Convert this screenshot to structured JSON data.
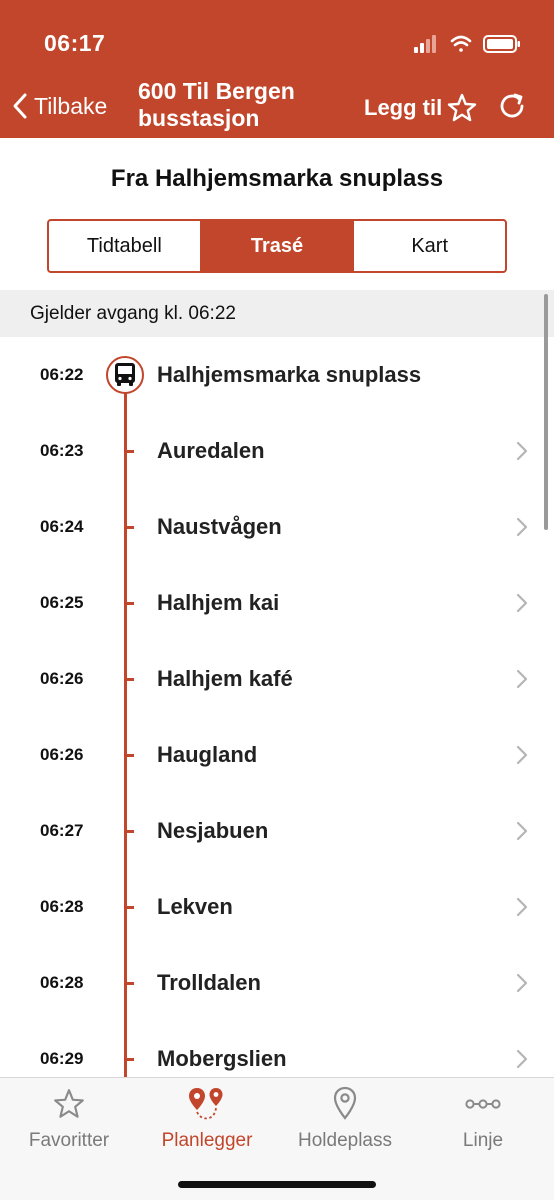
{
  "status_bar": {
    "time": "06:17"
  },
  "nav": {
    "back_label": "Tilbake",
    "title": "600 Til Bergen busstasjon",
    "add_label": "Legg til"
  },
  "from_title": "Fra Halhjemsmarka snuplass",
  "segments": [
    {
      "label": "Tidtabell",
      "active": false
    },
    {
      "label": "Trasé",
      "active": true
    },
    {
      "label": "Kart",
      "active": false
    }
  ],
  "departure_banner": "Gjelder avgang kl. 06:22",
  "stops": [
    {
      "time": "06:22",
      "name": "Halhjemsmarka snuplass"
    },
    {
      "time": "06:23",
      "name": "Auredalen"
    },
    {
      "time": "06:24",
      "name": "Naustvågen"
    },
    {
      "time": "06:25",
      "name": "Halhjem kai"
    },
    {
      "time": "06:26",
      "name": "Halhjem kafé"
    },
    {
      "time": "06:26",
      "name": "Haugland"
    },
    {
      "time": "06:27",
      "name": "Nesjabuen"
    },
    {
      "time": "06:28",
      "name": "Lekven"
    },
    {
      "time": "06:28",
      "name": "Trolldalen"
    },
    {
      "time": "06:29",
      "name": "Mobergslien"
    }
  ],
  "tabs": [
    {
      "label": "Favoritter",
      "icon": "star-icon",
      "active": false
    },
    {
      "label": "Planlegger",
      "icon": "route-pins-icon",
      "active": true
    },
    {
      "label": "Holdeplass",
      "icon": "location-pin-icon",
      "active": false
    },
    {
      "label": "Linje",
      "icon": "line-stops-icon",
      "active": false
    }
  ],
  "colors": {
    "accent": "#c2462b",
    "inactive": "#7a7a7a",
    "banner_bg": "#efefef"
  }
}
